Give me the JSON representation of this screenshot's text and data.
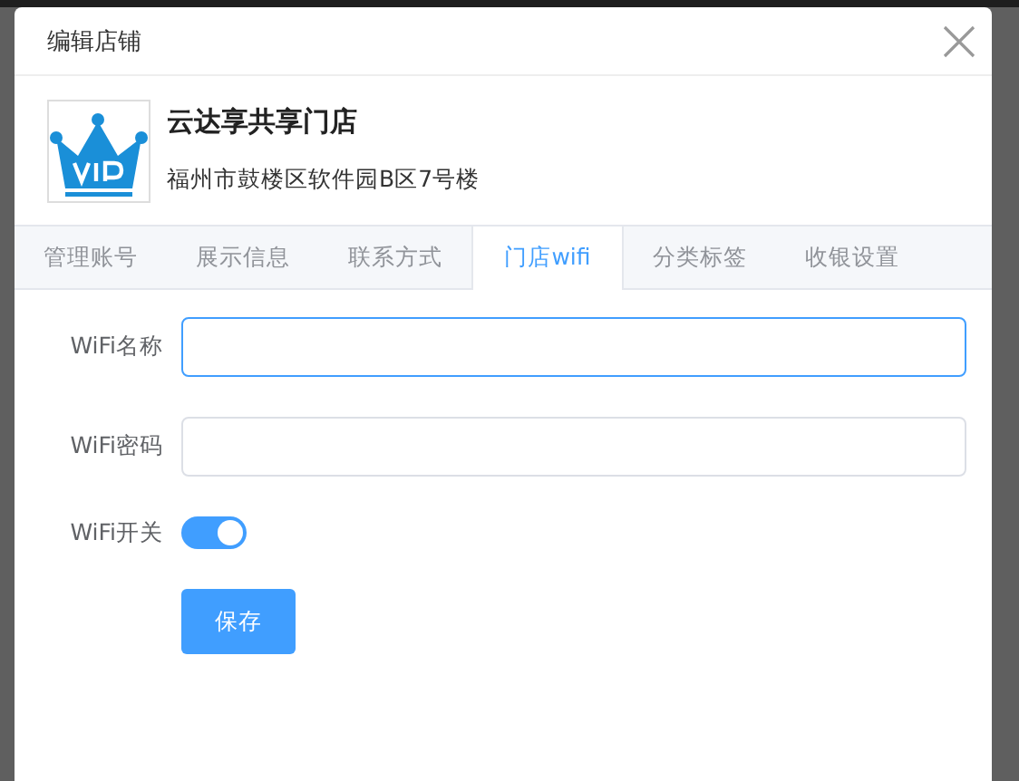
{
  "dialog": {
    "title": "编辑店铺"
  },
  "store": {
    "name": "云达享共享门店",
    "address": "福州市鼓楼区软件园B区7号楼"
  },
  "tabs": [
    {
      "label": "管理账号",
      "selected": false
    },
    {
      "label": "展示信息",
      "selected": false
    },
    {
      "label": "联系方式",
      "selected": false
    },
    {
      "label": "门店wifi",
      "selected": true
    },
    {
      "label": "分类标签",
      "selected": false
    },
    {
      "label": "收银设置",
      "selected": false
    }
  ],
  "form": {
    "fields": [
      {
        "kind": "text",
        "label": "WiFi名称",
        "focused": true
      },
      {
        "kind": "text",
        "label": "WiFi密码",
        "focused": false
      },
      {
        "kind": "switch",
        "label": "WiFi开关",
        "on": true
      }
    ],
    "save_button": "保存"
  }
}
